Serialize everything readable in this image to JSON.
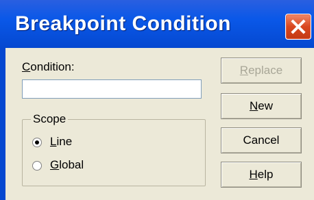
{
  "window": {
    "title": "Breakpoint Condition"
  },
  "condition": {
    "label_first": "C",
    "label_rest": "ondition:",
    "value": ""
  },
  "scope": {
    "legend": "Scope",
    "options": [
      {
        "mnemonic": "L",
        "rest": "ine",
        "selected": true
      },
      {
        "mnemonic": "G",
        "rest": "lobal",
        "selected": false
      }
    ]
  },
  "buttons": {
    "replace": {
      "mnemonic": "R",
      "rest": "eplace",
      "enabled": false
    },
    "new": {
      "mnemonic": "N",
      "rest": "ew",
      "enabled": true
    },
    "cancel": {
      "label": "Cancel",
      "enabled": true
    },
    "help": {
      "mnemonic": "H",
      "rest": "elp",
      "enabled": true
    }
  }
}
